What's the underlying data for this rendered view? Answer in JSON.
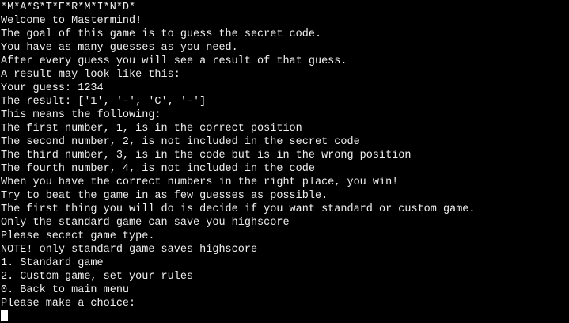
{
  "terminal": {
    "lines": [
      "*M*A*S*T*E*R*M*I*N*D*",
      "Welcome to Mastermind!",
      "The goal of this game is to guess the secret code.",
      "You have as many guesses as you need.",
      "After every guess you will see a result of that guess.",
      "A result may look like this:",
      "Your guess: 1234",
      "The result: ['1', '-', 'C', '-']",
      "This means the following:",
      "The first number, 1, is in the correct position",
      "The second number, 2, is not included in the secret code",
      "The third number, 3, is in the code but is in the wrong position",
      "The fourth number, 4, is not included in the code",
      "When you have the correct numbers in the right place, you win!",
      "Try to beat the game in as few guesses as possible.",
      "The first thing you will do is decide if you want standard or custom game.",
      "Only the standard game can save you highscore",
      "Please secect game type.",
      "NOTE! only standard game saves highscore",
      "1. Standard game",
      "2. Custom game, set your rules",
      "0. Back to main menu",
      "Please make a choice:"
    ],
    "input_value": ""
  },
  "colors": {
    "background": "#000000",
    "foreground": "#f0f0f0",
    "cursor": "#ffffff"
  }
}
